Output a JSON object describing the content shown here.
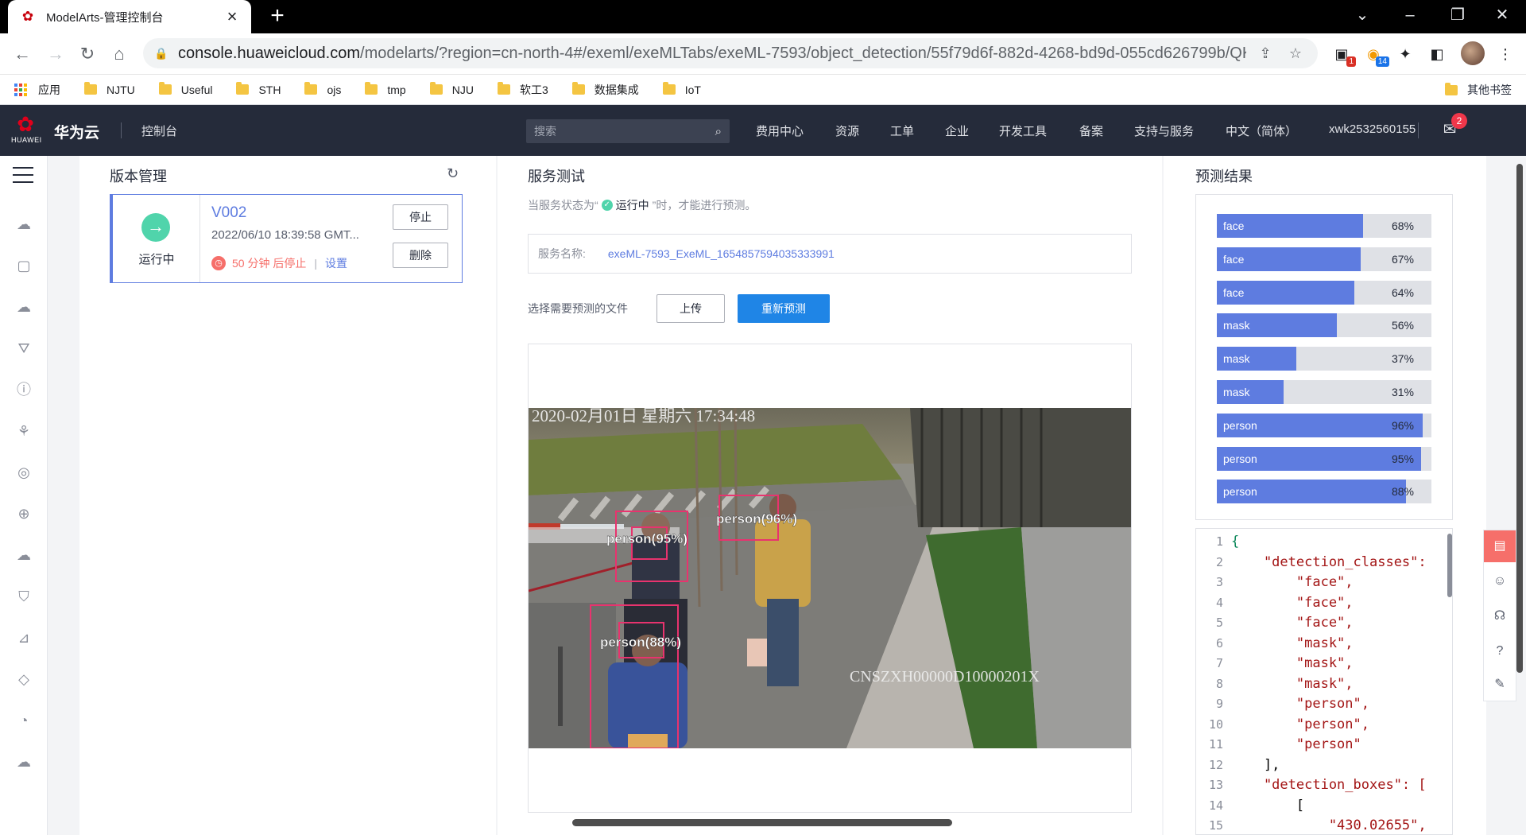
{
  "browser": {
    "tab_title": "ModelArts-管理控制台",
    "url_host": "console.huaweicloud.com",
    "url_path": "/modelarts/?region=cn-north-4#/exeml/exeMLTabs/exeML-7593/object_detection/55f79d6f-882d-4268-bd9d-055cd626799b/QK...",
    "ext_badge_1": "1",
    "ext_badge_2": "14",
    "bookmarks": [
      "应用",
      "NJTU",
      "Useful",
      "STH",
      "ojs",
      "tmp",
      "NJU",
      "软工3",
      "数据集成",
      "IoT"
    ],
    "other_bookmarks": "其他书签"
  },
  "header": {
    "logo_word": "HUAWEI",
    "brand": "华为云",
    "console": "控制台",
    "search_placeholder": "搜索",
    "nav": [
      "费用中心",
      "资源",
      "工单",
      "企业",
      "开发工具",
      "备案",
      "支持与服务",
      "中文（简体）",
      "xwk2532560155"
    ],
    "mail_count": "2"
  },
  "version_panel": {
    "title": "版本管理",
    "version": "V002",
    "status": "运行中",
    "created": "2022/06/10 18:39:58 GMT...",
    "countdown": "50 分钟 后停止",
    "settings_link": "设置",
    "stop_button": "停止",
    "delete_button": "删除"
  },
  "test_panel": {
    "title": "服务测试",
    "hint_prefix": "当服务状态为“",
    "hint_status": "运行中",
    "hint_suffix": "”时，才能进行预测。",
    "service_label": "服务名称:",
    "service_name": "exeML-7593_ExeML_1654857594035333991",
    "file_label": "选择需要预测的文件",
    "upload_button": "上传",
    "repredict_button": "重新预测",
    "image_timestamp": "2020-02月01日 星期六 17:34:48",
    "image_camera_id": "CNSZXH00000D10000201X",
    "box_labels": [
      "person(95%)",
      "person(96%)",
      "person(88%)"
    ]
  },
  "result_panel": {
    "title": "预测结果",
    "predictions": [
      {
        "class": "face",
        "score": 68,
        "label": "68%"
      },
      {
        "class": "face",
        "score": 67,
        "label": "67%"
      },
      {
        "class": "face",
        "score": 64,
        "label": "64%"
      },
      {
        "class": "mask",
        "score": 56,
        "label": "56%"
      },
      {
        "class": "mask",
        "score": 37,
        "label": "37%"
      },
      {
        "class": "mask",
        "score": 31,
        "label": "31%"
      },
      {
        "class": "person",
        "score": 96,
        "label": "96%"
      },
      {
        "class": "person",
        "score": 95,
        "label": "95%"
      },
      {
        "class": "person",
        "score": 88,
        "label": "88%"
      }
    ],
    "json_lines": [
      "{",
      "    \"detection_classes\":",
      "        \"face\",",
      "        \"face\",",
      "        \"face\",",
      "        \"mask\",",
      "        \"mask\",",
      "        \"mask\",",
      "        \"person\",",
      "        \"person\",",
      "        \"person\"",
      "    ],",
      "    \"detection_boxes\": [",
      "        [",
      "            \"430.02655\","
    ]
  },
  "colors": {
    "brand_red": "#e0001b",
    "header_bg": "#252b3a",
    "primary_blue": "#1f85e6",
    "bar_fill": "#5e7ce0",
    "running_green": "#50d4ab",
    "box_pink": "#e8336e"
  }
}
